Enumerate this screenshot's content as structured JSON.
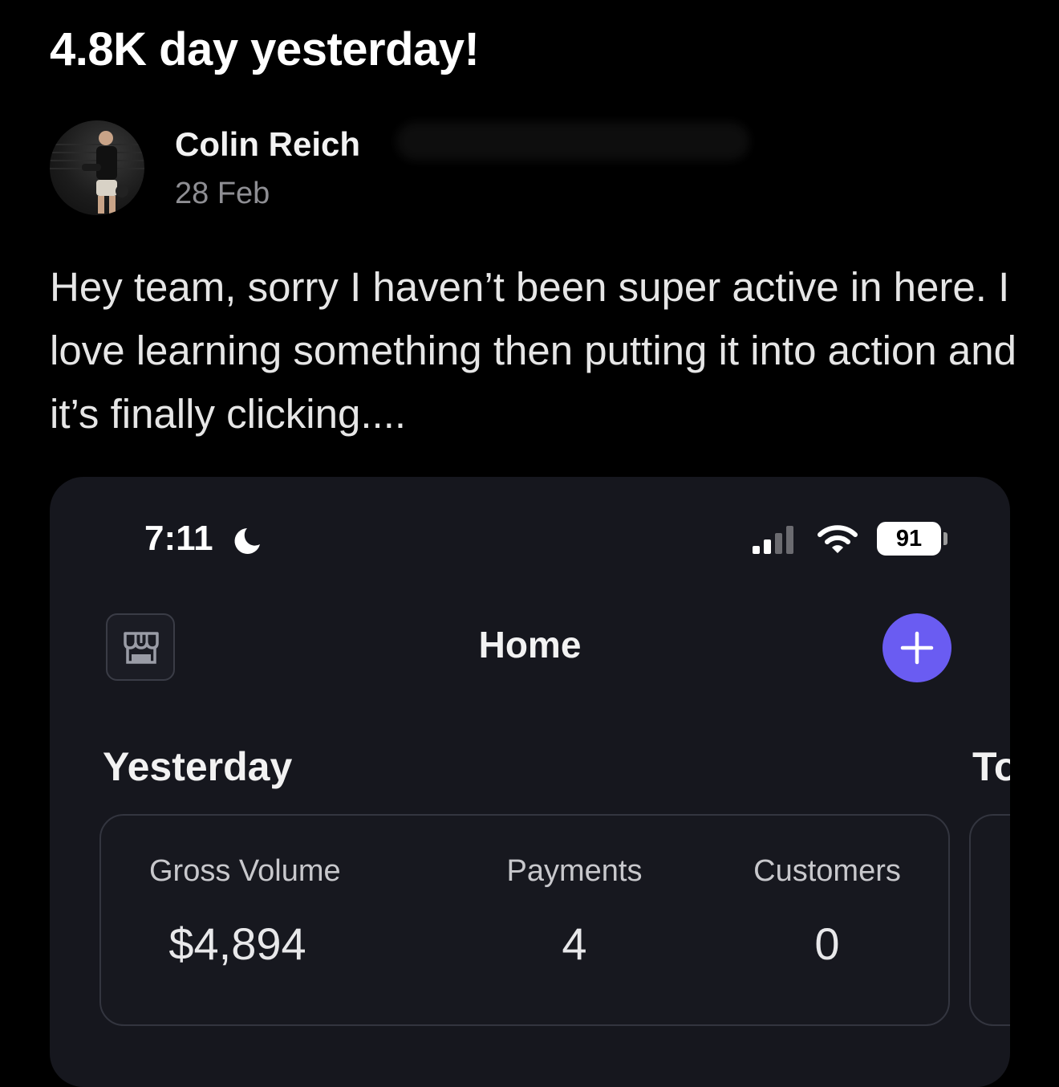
{
  "post": {
    "title": "4.8K day yesterday!",
    "author": "Colin Reich",
    "date": "28 Feb",
    "body": "Hey team, sorry I haven’t been super active in here. I love learning something then putting it into action and it’s finally clicking...."
  },
  "screenshot": {
    "status_bar": {
      "time": "7:11",
      "battery": "91"
    },
    "header": {
      "title": "Home"
    },
    "sections": {
      "yesterday": "Yesterday",
      "next_partial": "To"
    },
    "stats": [
      {
        "label": "Gross Volume",
        "value": "$4,894"
      },
      {
        "label": "Payments",
        "value": "4"
      },
      {
        "label": "Customers",
        "value": "0"
      }
    ],
    "colors": {
      "accent": "#6a5cf2",
      "background": "#16171e"
    },
    "icons": [
      "moon-icon",
      "signal-icon",
      "wifi-icon",
      "store-icon",
      "plus-icon"
    ]
  }
}
